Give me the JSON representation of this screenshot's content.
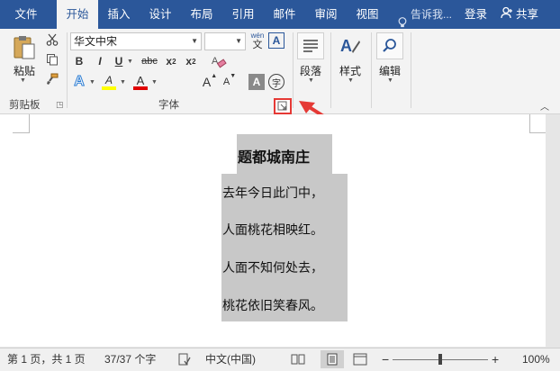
{
  "tabs": [
    {
      "label": "文件",
      "active": false
    },
    {
      "label": "开始",
      "active": true
    },
    {
      "label": "插入",
      "active": false
    },
    {
      "label": "设计",
      "active": false
    },
    {
      "label": "布局",
      "active": false
    },
    {
      "label": "引用",
      "active": false
    },
    {
      "label": "邮件",
      "active": false
    },
    {
      "label": "审阅",
      "active": false
    },
    {
      "label": "视图",
      "active": false
    }
  ],
  "tell_me": "告诉我...",
  "login": "登录",
  "share": "共享",
  "clipboard": {
    "paste_label": "粘贴",
    "group_label": "剪贴板"
  },
  "font": {
    "font_name": "华文中宋",
    "font_size": "",
    "wen_label": "wén",
    "wen_char": "文",
    "bold": "B",
    "italic": "I",
    "underline": "U",
    "strike": "abc",
    "sub": "x",
    "sup": "x",
    "sub_num": "2",
    "sup_num": "2",
    "grow": "A",
    "shrink": "A",
    "highlight_letter": "A",
    "color_letter": "A",
    "effects_letter": "A",
    "char_shade": "A",
    "encircle": "字",
    "group_label": "字体"
  },
  "paragraph": {
    "label": "段落"
  },
  "styles": {
    "label": "样式"
  },
  "editing": {
    "label": "编辑"
  },
  "document": {
    "title": "题都城南庄",
    "lines": [
      "去年今日此门中，",
      "人面桃花相映红。",
      "人面不知何处去，",
      "桃花依旧笑春风。"
    ]
  },
  "status": {
    "page": "第 1 页，共 1 页",
    "words": "37/37 个字",
    "lang": "中文(中国)",
    "zoom": "100%",
    "minus": "−",
    "plus": "+"
  },
  "colors": {
    "ribbon_blue": "#2b579a",
    "highlight_box": "#e53935"
  }
}
